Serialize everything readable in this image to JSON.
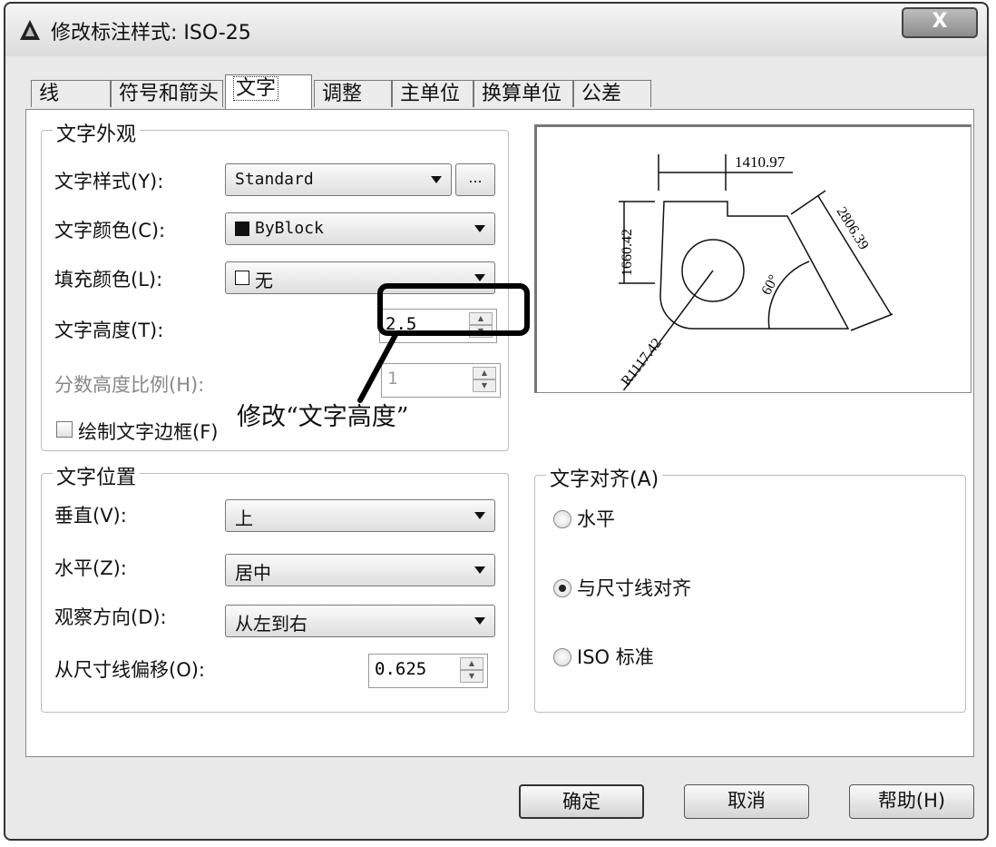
{
  "window": {
    "title": "修改标注样式: ISO-25",
    "close_label": "X"
  },
  "tabs": [
    {
      "label": "线"
    },
    {
      "label": "符号和箭头"
    },
    {
      "label": "文字",
      "active": true
    },
    {
      "label": "调整"
    },
    {
      "label": "主单位"
    },
    {
      "label": "换算单位"
    },
    {
      "label": "公差"
    }
  ],
  "appearance": {
    "group_label": "文字外观",
    "text_style_label": "文字样式(Y):",
    "text_style_value": "Standard",
    "browse_label": "...",
    "text_color_label": "文字颜色(C):",
    "text_color_value": "ByBlock",
    "fill_color_label": "填充颜色(L):",
    "fill_color_value": "无",
    "text_height_label": "文字高度(T):",
    "text_height_value": "2.5",
    "fraction_scale_label": "分数高度比例(H):",
    "fraction_scale_value": "1",
    "draw_frame_label": "绘制文字边框(F)",
    "draw_frame_checked": false
  },
  "annotation": {
    "text": "修改“文字高度”",
    "color": "#000000"
  },
  "placement": {
    "group_label": "文字位置",
    "vertical_label": "垂直(V):",
    "vertical_value": "上",
    "horizontal_label": "水平(Z):",
    "horizontal_value": "居中",
    "view_dir_label": "观察方向(D):",
    "view_dir_value": "从左到右",
    "offset_label": "从尺寸线偏移(O):",
    "offset_value": "0.625"
  },
  "alignment": {
    "group_label": "文字对齐(A)",
    "options": [
      {
        "label": "水平",
        "selected": false
      },
      {
        "label": "与尺寸线对齐",
        "selected": true
      },
      {
        "label": "ISO 标准",
        "selected": false
      }
    ]
  },
  "preview": {
    "dim_top": "1410.97",
    "dim_left": "1660.42",
    "dim_right": "2806.39",
    "dim_angle": "60°",
    "dim_radius": "R1117.42"
  },
  "buttons": {
    "ok": "确定",
    "cancel": "取消",
    "help": "帮助(H)"
  }
}
